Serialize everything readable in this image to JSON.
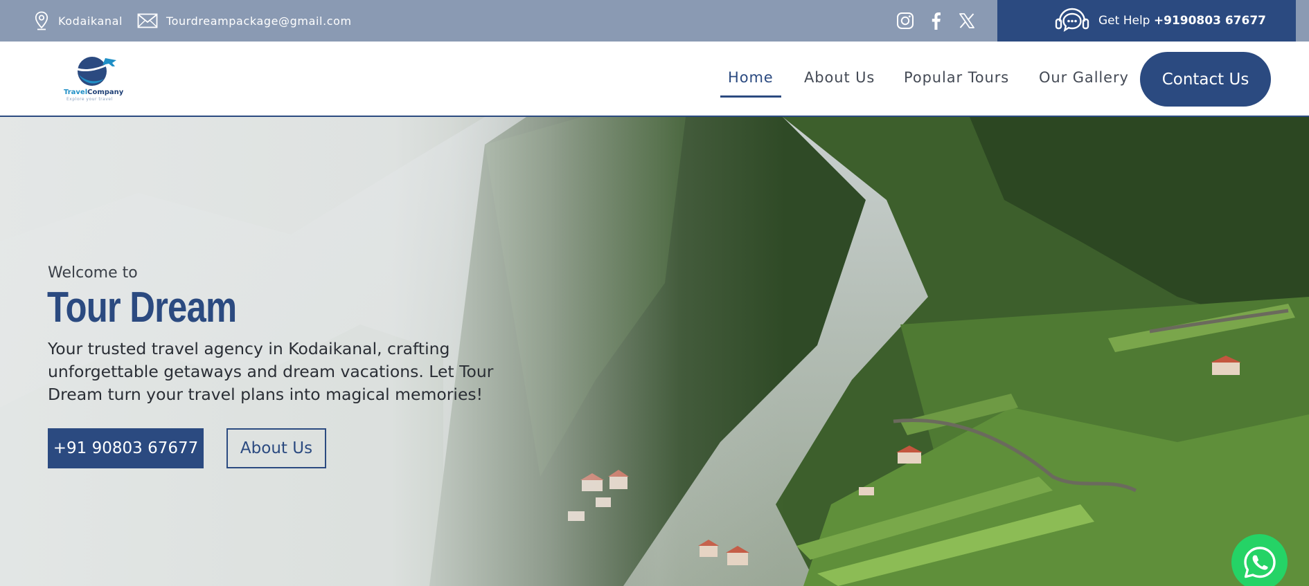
{
  "topbar": {
    "location": "Kodaikanal",
    "email": "Tourdreampackage@gmail.com",
    "social": [
      "instagram-icon",
      "facebook-icon",
      "x-icon"
    ],
    "help_label": "Get Help",
    "help_phone": "+9190803 67677"
  },
  "brand": {
    "name_part1": "Travel",
    "name_part2": "Company",
    "tagline": "Explore your travel"
  },
  "nav": {
    "home": "Home",
    "about": "About Us",
    "tours": "Popular Tours",
    "gallery": "Our Gallery",
    "contact": "Contact Us"
  },
  "hero": {
    "welcome": "Welcome to",
    "title": "Tour Dream",
    "description": "Your trusted travel agency in Kodaikanal, crafting unforgettable getaways and dream vacations. Let Tour Dream turn your travel plans into magical memories!",
    "phone_button": "+91 90803 67677",
    "about_button": "About Us"
  },
  "colors": {
    "topbar": "#8a9ab3",
    "primary": "#2b4a80",
    "whatsapp": "#25d366"
  }
}
